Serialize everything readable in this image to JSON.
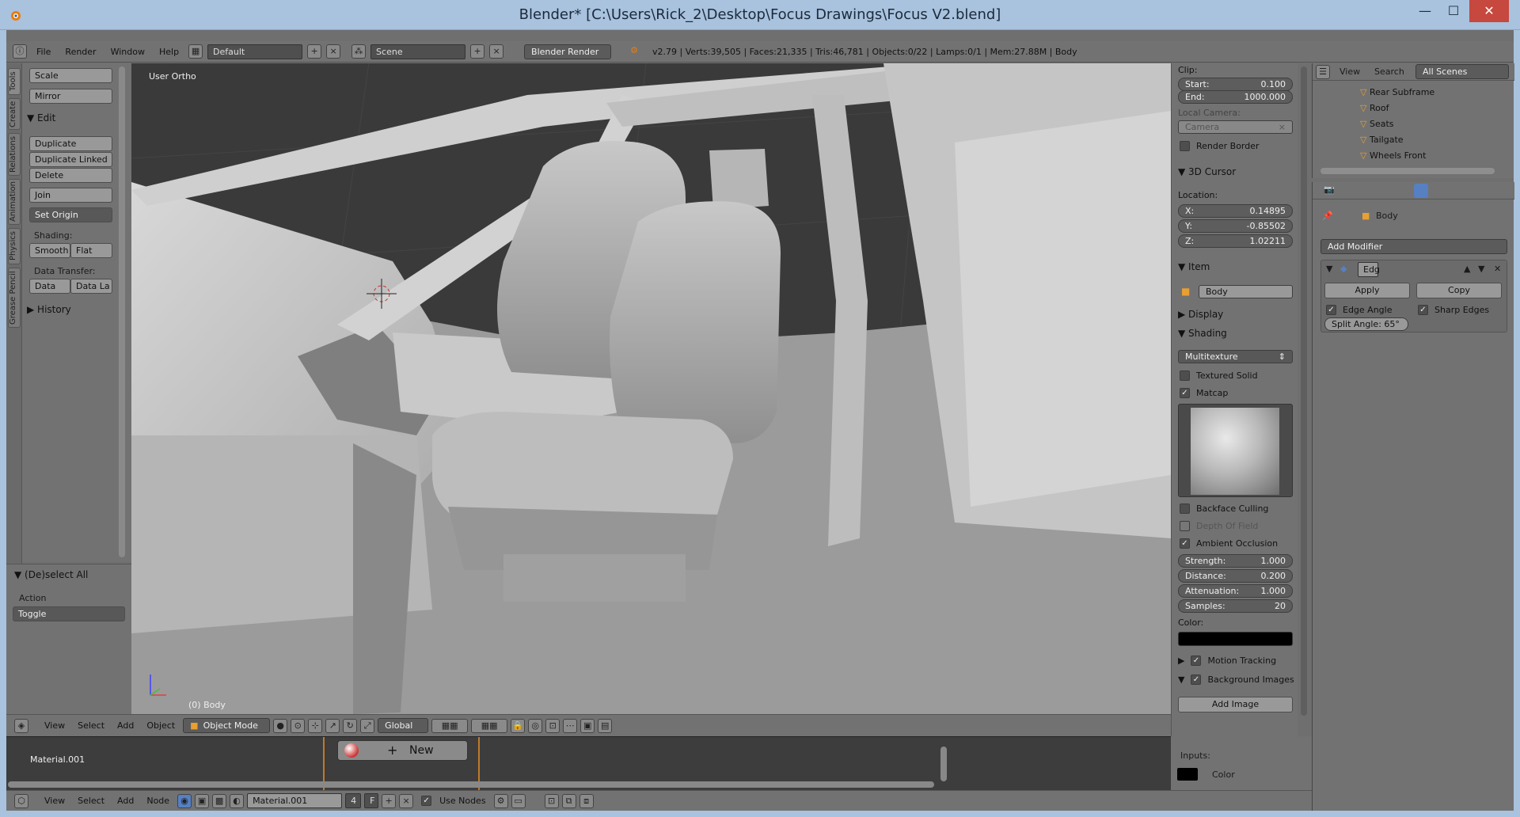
{
  "window": {
    "title": "Blender* [C:\\Users\\Rick_2\\Desktop\\Focus Drawings\\Focus V2.blend]",
    "minimize": "—",
    "maximize": "☐",
    "close": "✕"
  },
  "topbar": {
    "menus": [
      "File",
      "Render",
      "Window",
      "Help"
    ],
    "layout": "Default",
    "scene": "Scene",
    "engine": "Blender Render",
    "stats": "v2.79 | Verts:39,505 | Faces:21,335 | Tris:46,781 | Objects:0/22 | Lamps:0/1 | Mem:27.88M | Body"
  },
  "tool_tabs": [
    "Tools",
    "Create",
    "Relations",
    "Animation",
    "Physics",
    "Grease Pencil"
  ],
  "toolshelf": {
    "scale": "Scale",
    "mirror": "Mirror",
    "edit_header": "Edit",
    "duplicate": "Duplicate",
    "duplicate_linked": "Duplicate Linked",
    "delete": "Delete",
    "join": "Join",
    "set_origin": "Set Origin",
    "shading_label": "Shading:",
    "smooth": "Smooth",
    "flat": "Flat",
    "data_transfer_label": "Data Transfer:",
    "data": "Data",
    "data_la": "Data La",
    "history_header": "History"
  },
  "operator": {
    "header": "(De)select All",
    "action_label": "Action",
    "action_value": "Toggle"
  },
  "viewport": {
    "view_name": "User Ortho",
    "object_label": "(0) Body"
  },
  "vpheader": {
    "menus": [
      "View",
      "Select",
      "Add",
      "Object"
    ],
    "mode": "Object Mode",
    "orientation": "Global"
  },
  "npanel": {
    "clip_label": "Clip:",
    "start_label": "Start:",
    "start_value": "0.100",
    "end_label": "End:",
    "end_value": "1000.000",
    "local_camera_label": "Local Camera:",
    "camera_placeholder": "Camera",
    "render_border": "Render Border",
    "cursor_header": "3D Cursor",
    "location_label": "Location:",
    "x_label": "X:",
    "x_value": "0.14895",
    "y_label": "Y:",
    "y_value": "-0.85502",
    "z_label": "Z:",
    "z_value": "1.02211",
    "item_header": "Item",
    "item_name": "Body",
    "display_header": "Display",
    "shading_header": "Shading",
    "shading_mode": "Multitexture",
    "textured_solid": "Textured Solid",
    "matcap": "Matcap",
    "backface_culling": "Backface Culling",
    "depth_of_field": "Depth Of Field",
    "ambient_occlusion": "Ambient Occlusion",
    "strength_label": "Strength:",
    "strength_value": "1.000",
    "distance_label": "Distance:",
    "distance_value": "0.200",
    "attenuation_label": "Attenuation:",
    "attenuation_value": "1.000",
    "samples_label": "Samples:",
    "samples_value": "20",
    "color_label": "Color:",
    "motion_tracking": "Motion Tracking",
    "background_images": "Background Images",
    "add_image": "Add Image"
  },
  "outliner": {
    "menus": [
      "View",
      "Search"
    ],
    "scenes": "All Scenes",
    "items": [
      "Rear Subframe",
      "Roof",
      "Seats",
      "Tailgate",
      "Wheels Front"
    ]
  },
  "properties": {
    "object_name": "Body",
    "add_modifier": "Add Modifier",
    "modifier_name": "Edg",
    "apply": "Apply",
    "copy": "Copy",
    "edge_angle": "Edge Angle",
    "sharp_edges": "Sharp Edges",
    "split_angle": "Split Angle: 65°"
  },
  "nodeeditor": {
    "material": "Material.001",
    "new_button": "New",
    "inputs_label": "Inputs:",
    "color_label": "Color"
  },
  "nodeheader": {
    "menus": [
      "View",
      "Select",
      "Add",
      "Node"
    ],
    "material": "Material.001",
    "users": "4",
    "fake": "F",
    "use_nodes": "Use Nodes"
  }
}
